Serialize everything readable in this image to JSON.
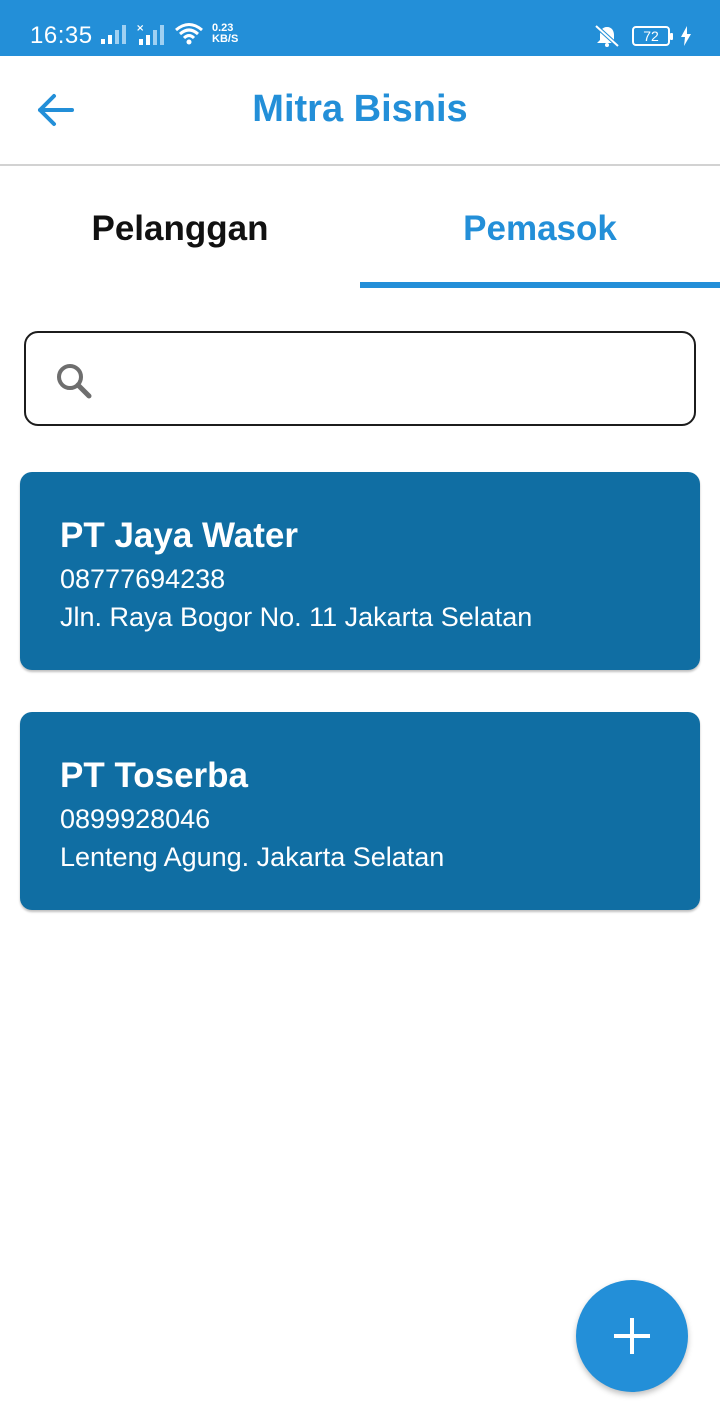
{
  "status_bar": {
    "time": "16:35",
    "net_speed_value": "0.23",
    "net_speed_unit": "KB/S",
    "battery": "72",
    "icons": [
      "signal-icon",
      "signal-no-data-icon",
      "wifi-icon",
      "vibrate-mute-icon",
      "battery-icon",
      "charging-icon"
    ]
  },
  "app_bar": {
    "title": "Mitra Bisnis",
    "back_icon": "arrow-left-icon"
  },
  "tabs": [
    {
      "label": "Pelanggan",
      "selected": false
    },
    {
      "label": "Pemasok",
      "selected": true
    }
  ],
  "search": {
    "icon": "search-icon",
    "value": "",
    "placeholder": ""
  },
  "partners": [
    {
      "name": "PT Jaya Water",
      "phone": "08777694238",
      "address": "Jln. Raya Bogor No. 11 Jakarta Selatan"
    },
    {
      "name": "PT Toserba",
      "phone": "0899928046",
      "address": "Lenteng Agung. Jakarta Selatan"
    }
  ],
  "fab": {
    "icon": "plus-icon"
  },
  "colors": {
    "primary": "#238fd8",
    "card": "#106ea3",
    "text_dark": "#111111"
  }
}
